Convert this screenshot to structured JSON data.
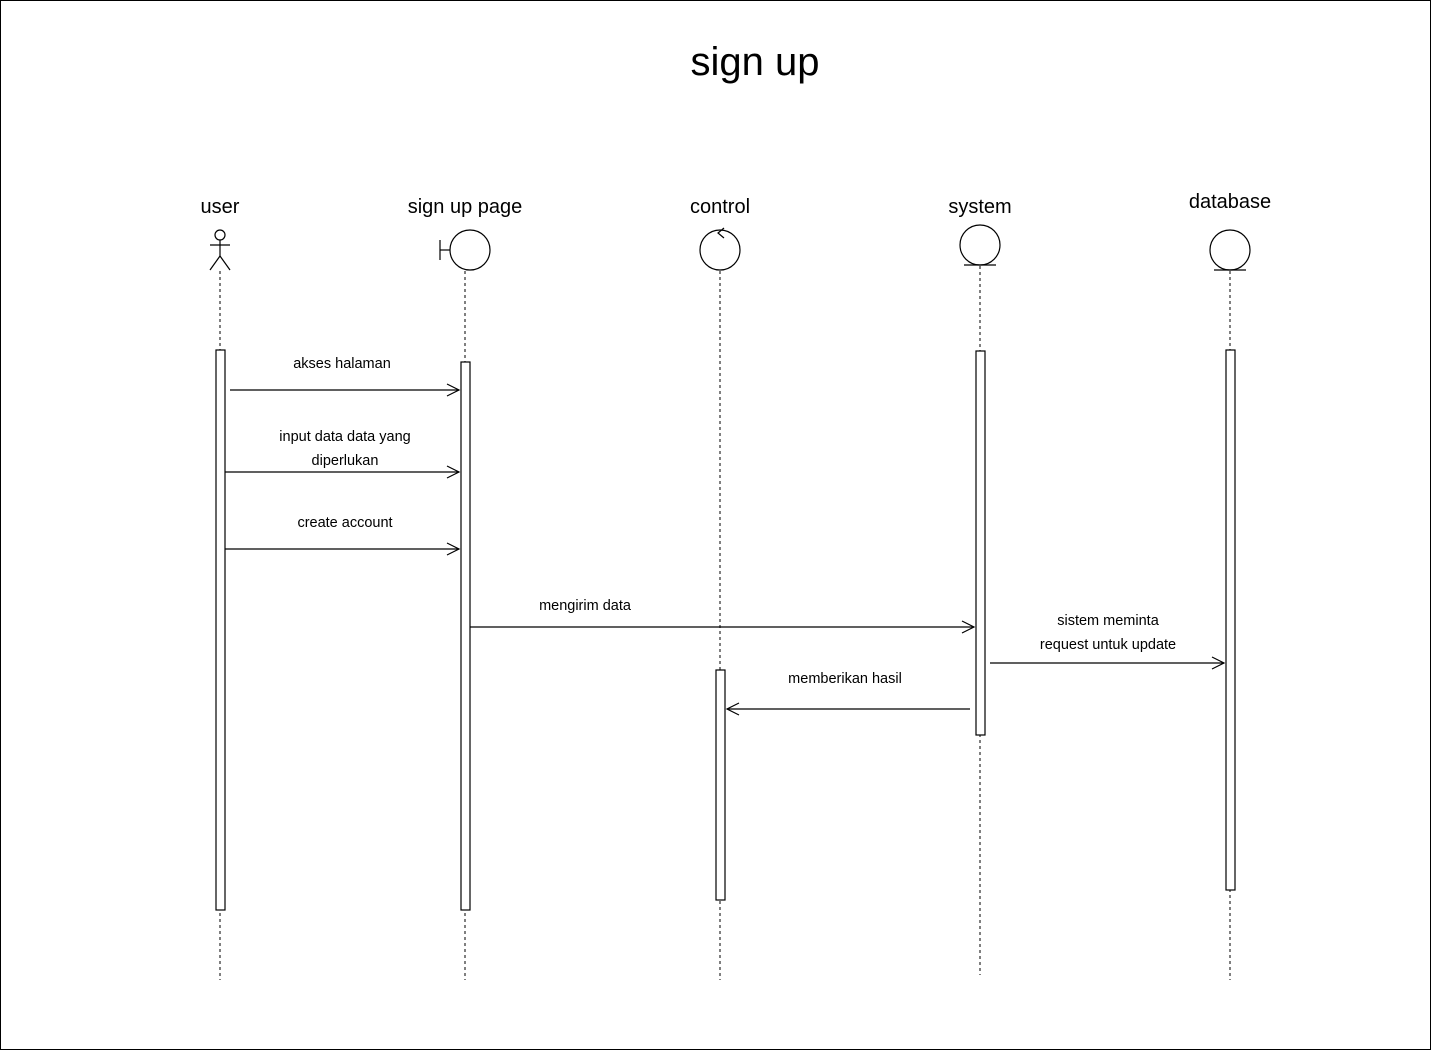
{
  "diagram": {
    "title": "sign up",
    "participants": [
      {
        "id": "user",
        "label": "user",
        "kind": "actor"
      },
      {
        "id": "signup",
        "label": "sign up page",
        "kind": "boundary"
      },
      {
        "id": "control",
        "label": "control",
        "kind": "control"
      },
      {
        "id": "system",
        "label": "system",
        "kind": "entity"
      },
      {
        "id": "database",
        "label": "database",
        "kind": "entity"
      }
    ],
    "messages": [
      {
        "from": "user",
        "to": "signup",
        "lines": [
          "akses halaman"
        ]
      },
      {
        "from": "user",
        "to": "signup",
        "lines": [
          "input data data yang",
          "diperlukan"
        ]
      },
      {
        "from": "user",
        "to": "signup",
        "lines": [
          "create account"
        ]
      },
      {
        "from": "signup",
        "to": "system",
        "lines": [
          "mengirim data"
        ]
      },
      {
        "from": "system",
        "to": "database",
        "lines": [
          "sistem meminta",
          "request untuk update"
        ]
      },
      {
        "from": "system",
        "to": "control",
        "lines": [
          "memberikan hasil"
        ]
      }
    ],
    "colors": {
      "stroke": "#000000",
      "background": "#ffffff"
    }
  }
}
